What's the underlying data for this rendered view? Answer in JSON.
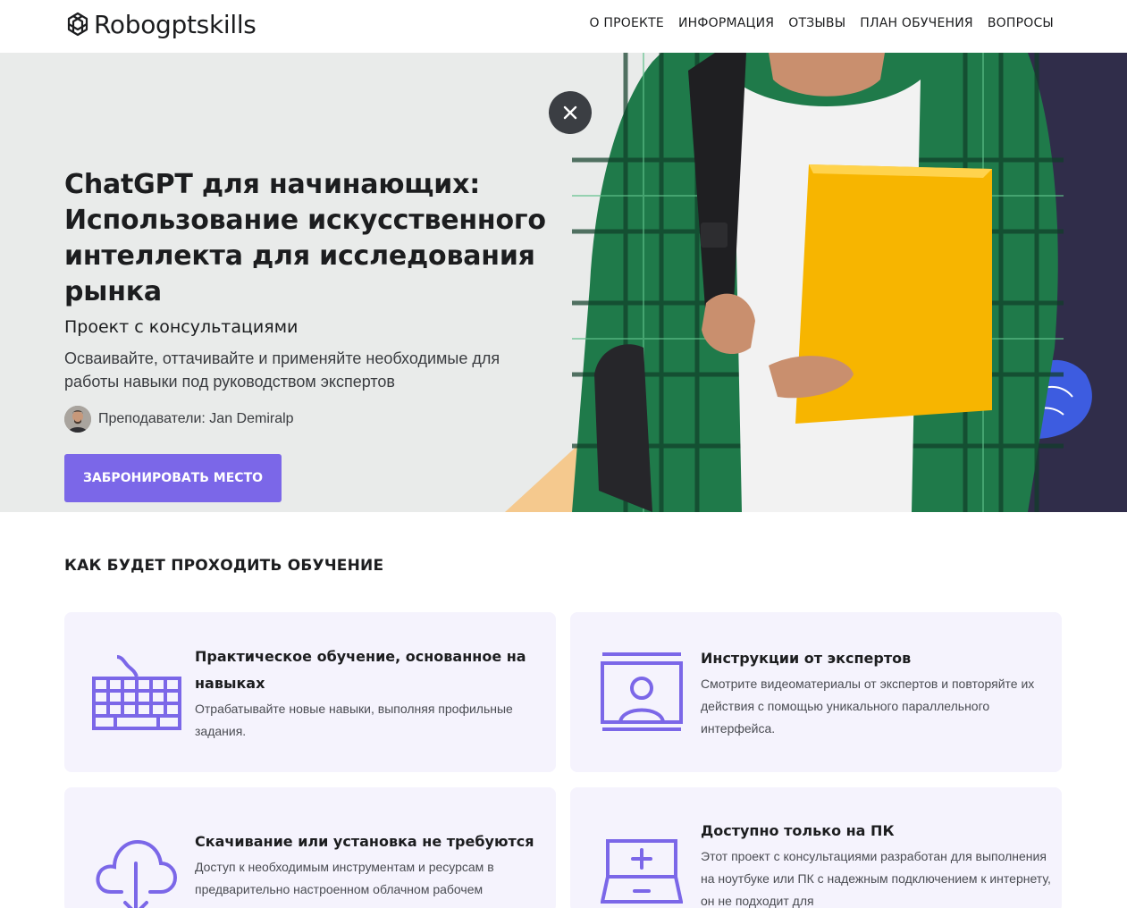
{
  "header": {
    "logo_text": "Robogptskills",
    "nav": [
      "О ПРОЕКТЕ",
      "ИНФОРМАЦИЯ",
      "ОТЗЫВЫ",
      "ПЛАН ОБУЧЕНИЯ",
      "ВОПРОСЫ"
    ]
  },
  "hero": {
    "title": "ChatGPT для начинающих: Использование искусственного интеллекта для исследования рынка",
    "subtitle": "Проект с консультациями",
    "description": "Осваивайте, оттачивайте и применяйте необходимые для работы навыки под руководством экспертов",
    "instructor": "Преподаватели: Jan Demiralp",
    "cta_label": "ЗАБРОНИРОВАТЬ МЕСТО"
  },
  "section": {
    "title": "КАК БУДЕТ ПРОХОДИТЬ ОБУЧЕНИЕ",
    "cards": [
      {
        "icon": "keyboard-icon",
        "title": "Практическое обучение, основанное на навыках",
        "text": "Отрабатывайте новые навыки, выполняя профильные задания."
      },
      {
        "icon": "video-instructor-icon",
        "title": "Инструкции от экспертов",
        "text": "Смотрите видеоматериалы от экспертов и повторяйте их действия с помощью уникального параллельного интерфейса."
      },
      {
        "icon": "cloud-download-icon",
        "title": "Скачивание или установка не требуются",
        "text": "Доступ к необходимым инструментам и ресурсам в предварительно настроенном облачном рабочем"
      },
      {
        "icon": "computer-icon",
        "title": "Доступно только на ПК",
        "text": "Этот проект с консультациями разработан для выполнения на ноутбуке или ПК с надежным подключением к интернету, он не подходит для"
      }
    ]
  },
  "colors": {
    "accent": "#7b67e8",
    "hero_bg": "#e9ebea",
    "card_bg": "#f5f3fd",
    "navy": "#302d4a",
    "peach": "#f5c98e"
  }
}
